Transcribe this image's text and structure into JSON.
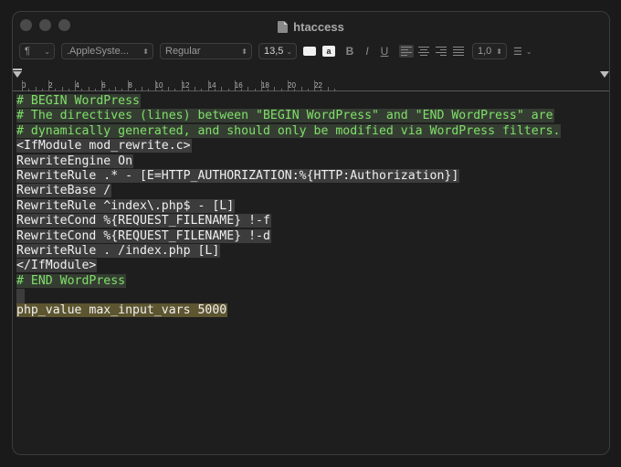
{
  "window": {
    "title": "htaccess",
    "traffic_lights": [
      "close",
      "minimize",
      "zoom"
    ]
  },
  "toolbar": {
    "paragraph_style": "¶",
    "font_family": ".AppleSyste...",
    "font_style": "Regular",
    "font_size": "13,5",
    "text_color_icon": "text-color-well",
    "background_color_label": "a",
    "bold_label": "B",
    "italic_label": "I",
    "underline_label": "U",
    "line_spacing": "1,0",
    "list_icon": "list-bullets"
  },
  "ruler": {
    "labels": [
      "0",
      "2",
      "4",
      "6",
      "8",
      "10",
      "12",
      "14",
      "16",
      "18",
      "20",
      "22"
    ]
  },
  "editor": {
    "lines": [
      {
        "text": "# BEGIN WordPress",
        "style": "green"
      },
      {
        "text": "# The directives (lines) between \"BEGIN WordPress\" and \"END WordPress\" are",
        "style": "green"
      },
      {
        "text": "# dynamically generated, and should only be modified via WordPress filters.",
        "style": "green"
      },
      {
        "text": "<IfModule mod_rewrite.c>",
        "style": "gray"
      },
      {
        "text": "RewriteEngine On",
        "style": "gray"
      },
      {
        "text": "RewriteRule .* - [E=HTTP_AUTHORIZATION:%{HTTP:Authorization}]",
        "style": "gray"
      },
      {
        "text": "RewriteBase /",
        "style": "gray"
      },
      {
        "text": "RewriteRule ^index\\.php$ - [L]",
        "style": "gray"
      },
      {
        "text": "RewriteCond %{REQUEST_FILENAME} !-f",
        "style": "gray"
      },
      {
        "text": "RewriteCond %{REQUEST_FILENAME} !-d",
        "style": "gray"
      },
      {
        "text": "RewriteRule . /index.php [L]",
        "style": "gray"
      },
      {
        "text": "</IfModule>",
        "style": "gray"
      },
      {
        "text": "# END WordPress",
        "style": "green"
      },
      {
        "text": "",
        "style": "caret"
      },
      {
        "text": "php_value max_input_vars 5000",
        "style": "olive"
      }
    ]
  },
  "colors": {
    "background": "#1e1e1e",
    "comment_text": "#7fe06a",
    "highlight_gray": "#3c3c3c",
    "highlight_olive": "#5d5530"
  }
}
